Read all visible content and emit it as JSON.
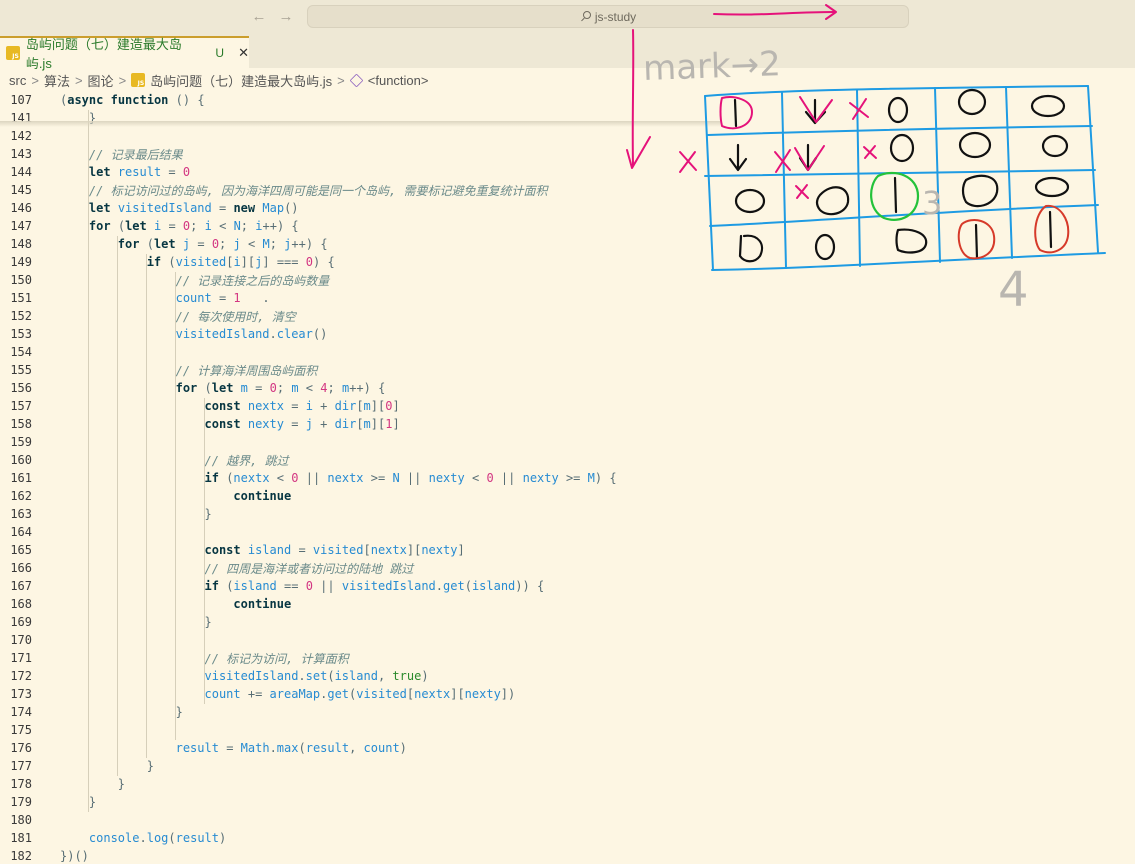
{
  "titlebar": {
    "back_icon": "←",
    "forward_icon": "→",
    "search_text": "js-study"
  },
  "tab": {
    "filename": "岛屿问题（七）建造最大岛屿.js",
    "modified": "U",
    "close": "✕"
  },
  "breadcrumb": {
    "items": [
      "src",
      "算法",
      "图论",
      "岛屿问题（七）建造最大岛屿.js",
      "<function>"
    ],
    "separator": ">"
  },
  "code": {
    "lines": [
      {
        "n": "107",
        "t": "(async function () {"
      },
      {
        "n": "141",
        "t": "    }"
      },
      {
        "n": "142",
        "t": ""
      },
      {
        "n": "143",
        "t": "    // 记录最后结果"
      },
      {
        "n": "144",
        "t": "    let result = 0"
      },
      {
        "n": "145",
        "t": "    // 标记访问过的岛屿, 因为海洋四周可能是同一个岛屿, 需要标记避免重复统计面积"
      },
      {
        "n": "146",
        "t": "    let visitedIsland = new Map()"
      },
      {
        "n": "147",
        "t": "    for (let i = 0; i < N; i++) {"
      },
      {
        "n": "148",
        "t": "        for (let j = 0; j < M; j++) {"
      },
      {
        "n": "149",
        "t": "            if (visited[i][j] === 0) {"
      },
      {
        "n": "150",
        "t": "                // 记录连接之后的岛屿数量"
      },
      {
        "n": "151",
        "t": "                count = 1   ."
      },
      {
        "n": "152",
        "t": "                // 每次使用时, 清空"
      },
      {
        "n": "153",
        "t": "                visitedIsland.clear()"
      },
      {
        "n": "154",
        "t": ""
      },
      {
        "n": "155",
        "t": "                // 计算海洋周围岛屿面积"
      },
      {
        "n": "156",
        "t": "                for (let m = 0; m < 4; m++) {"
      },
      {
        "n": "157",
        "t": "                    const nextx = i + dir[m][0]"
      },
      {
        "n": "158",
        "t": "                    const nexty = j + dir[m][1]"
      },
      {
        "n": "159",
        "t": ""
      },
      {
        "n": "160",
        "t": "                    // 越界, 跳过"
      },
      {
        "n": "161",
        "t": "                    if (nextx < 0 || nextx >= N || nexty < 0 || nexty >= M) {"
      },
      {
        "n": "162",
        "t": "                        continue"
      },
      {
        "n": "163",
        "t": "                    }"
      },
      {
        "n": "164",
        "t": ""
      },
      {
        "n": "165",
        "t": "                    const island = visited[nextx][nexty]"
      },
      {
        "n": "166",
        "t": "                    // 四周是海洋或者访问过的陆地 跳过"
      },
      {
        "n": "167",
        "t": "                    if (island == 0 || visitedIsland.get(island)) {"
      },
      {
        "n": "168",
        "t": "                        continue"
      },
      {
        "n": "169",
        "t": "                    }"
      },
      {
        "n": "170",
        "t": ""
      },
      {
        "n": "171",
        "t": "                    // 标记为访问, 计算面积"
      },
      {
        "n": "172",
        "t": "                    visitedIsland.set(island, true)"
      },
      {
        "n": "173",
        "t": "                    count += areaMap.get(visited[nextx][nexty])"
      },
      {
        "n": "174",
        "t": "                }"
      },
      {
        "n": "175",
        "t": ""
      },
      {
        "n": "176",
        "t": "                result = Math.max(result, count)"
      },
      {
        "n": "177",
        "t": "            }"
      },
      {
        "n": "178",
        "t": "        }"
      },
      {
        "n": "179",
        "t": "    }"
      },
      {
        "n": "180",
        "t": ""
      },
      {
        "n": "181",
        "t": "    console.log(result)"
      },
      {
        "n": "182",
        "t": "})()"
      }
    ]
  },
  "annotation": {
    "mark_label": "mark→2",
    "label_3": "3",
    "label_4": "4",
    "grid_rows": [
      [
        "1",
        "↓",
        "0",
        "0",
        "0"
      ],
      [
        "↓",
        "↓",
        "0",
        "0",
        "0"
      ],
      [
        "0",
        "0",
        "1",
        "0",
        "0"
      ],
      [
        "0",
        "0",
        "0",
        "1",
        "1"
      ]
    ],
    "colors": {
      "grid": "#1e9be3",
      "pink": "#e5127a",
      "red": "#d63a2a",
      "green": "#24c23a",
      "gray": "#b9b6b0",
      "ink": "#111111"
    }
  }
}
